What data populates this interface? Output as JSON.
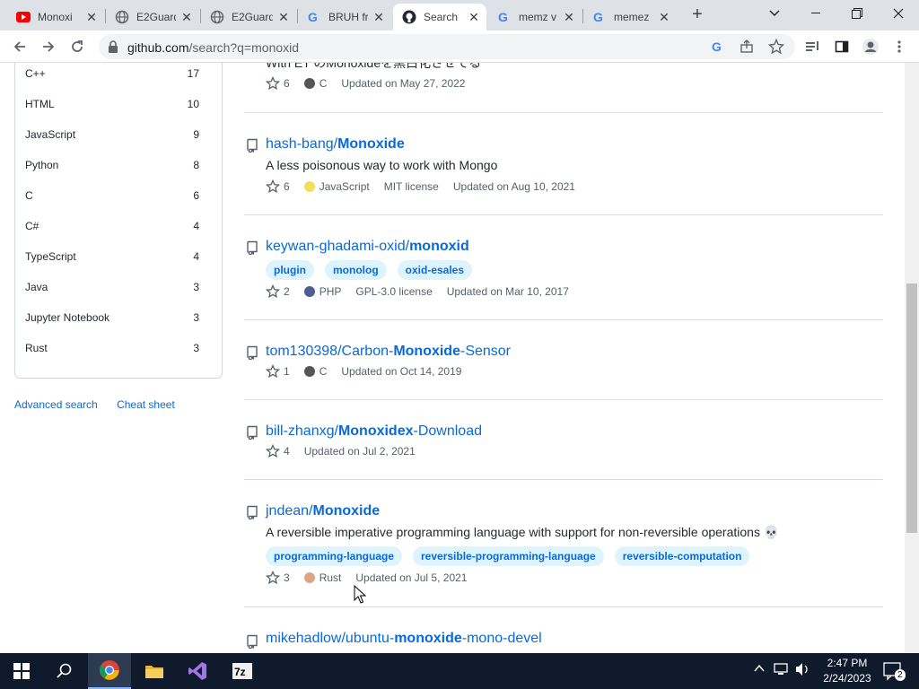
{
  "browser": {
    "tabs": [
      {
        "label": "Monoxi",
        "icon": "youtube-icon"
      },
      {
        "label": "E2Guard",
        "icon": "globe-icon"
      },
      {
        "label": "E2Guard",
        "icon": "globe-icon"
      },
      {
        "label": "BRUH fr",
        "icon": "google-icon"
      },
      {
        "label": "Search",
        "icon": "github-icon"
      },
      {
        "label": "memz v",
        "icon": "google-icon"
      },
      {
        "label": "memez",
        "icon": "google-icon"
      }
    ],
    "url_host": "github.com",
    "url_path": "/search?q=monoxid"
  },
  "sidebar": {
    "languages": [
      {
        "name": "C++",
        "count": "17"
      },
      {
        "name": "HTML",
        "count": "10"
      },
      {
        "name": "JavaScript",
        "count": "9"
      },
      {
        "name": "Python",
        "count": "8"
      },
      {
        "name": "C",
        "count": "6"
      },
      {
        "name": "C#",
        "count": "4"
      },
      {
        "name": "TypeScript",
        "count": "4"
      },
      {
        "name": "Java",
        "count": "3"
      },
      {
        "name": "Jupyter Notebook",
        "count": "3"
      },
      {
        "name": "Rust",
        "count": "3"
      }
    ],
    "advanced_search": "Advanced search",
    "cheat_sheet": "Cheat sheet"
  },
  "results": [
    {
      "partial_desc": "With ET のMonoxideを黒白化させてる",
      "stars": "6",
      "language": "C",
      "lang_color": "#555555",
      "updated": "Updated on May 27, 2022"
    },
    {
      "owner": "hash-bang/",
      "name_bold": "Monoxide",
      "name_rest": "",
      "desc": "A less poisonous way to work with Mongo",
      "stars": "6",
      "language": "JavaScript",
      "lang_color": "#f1e05a",
      "license": "MIT license",
      "updated": "Updated on Aug 10, 2021"
    },
    {
      "owner": "keywan-ghadami-oxid/",
      "name_bold": "monoxid",
      "name_rest": "",
      "topics": [
        "plugin",
        "monolog",
        "oxid-esales"
      ],
      "stars": "2",
      "language": "PHP",
      "lang_color": "#4F5D95",
      "license": "GPL-3.0 license",
      "updated": "Updated on Mar 10, 2017"
    },
    {
      "owner": "tom130398/Carbon-",
      "name_bold": "Monoxide",
      "name_rest": "-Sensor",
      "stars": "1",
      "language": "C",
      "lang_color": "#555555",
      "updated": "Updated on Oct 14, 2019"
    },
    {
      "owner": "bill-zhanxg/",
      "name_bold": "Monoxidex",
      "name_rest": "-Download",
      "stars": "4",
      "updated": "Updated on Jul 2, 2021"
    },
    {
      "owner": "jndean/",
      "name_bold": "Monoxide",
      "name_rest": "",
      "desc": "A reversible imperative programming language with support for non-reversible operations 💀",
      "topics": [
        "programming-language",
        "reversible-programming-language",
        "reversible-computation"
      ],
      "stars": "3",
      "language": "Rust",
      "lang_color": "#dea584",
      "updated": "Updated on Jul 5, 2021"
    },
    {
      "owner": "mikehadlow/ubuntu-",
      "name_bold": "monoxide",
      "name_rest": "-mono-devel"
    }
  ],
  "taskbar": {
    "time": "2:47 PM",
    "date": "2/24/2023",
    "notification_count": "2"
  }
}
